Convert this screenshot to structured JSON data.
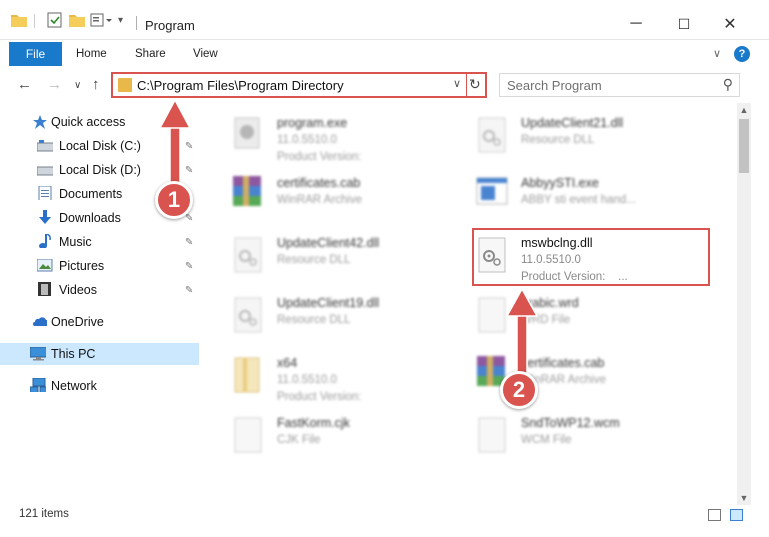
{
  "window": {
    "title": "Program",
    "minimize_glyph": "─",
    "maximize_glyph": "☐",
    "close_glyph": "✕"
  },
  "ribbon": {
    "tabs": [
      "File",
      "Home",
      "Share",
      "View"
    ],
    "expand_glyph": "∨",
    "help_glyph": "?"
  },
  "address": {
    "path": "C:\\Program Files\\Program Directory",
    "back_glyph": "←",
    "forward_glyph": "→",
    "recent_glyph": "∨",
    "up_glyph": "↑",
    "dropdown_glyph": "∨",
    "refresh_glyph": "↻"
  },
  "search": {
    "placeholder": "Search Program",
    "icon": "search-icon",
    "glyph": "⚲"
  },
  "navpane": {
    "items": [
      {
        "label": "Quick access",
        "icon": "star-icon"
      },
      {
        "label": "Local Disk (C:)",
        "icon": "drive-icon",
        "pinned": true
      },
      {
        "label": "Local Disk (D:)",
        "icon": "drive-icon",
        "pinned": true
      },
      {
        "label": "Documents",
        "icon": "documents-icon",
        "pinned": true
      },
      {
        "label": "Downloads",
        "icon": "downloads-icon",
        "pinned": true
      },
      {
        "label": "Music",
        "icon": "music-icon",
        "pinned": true
      },
      {
        "label": "Pictures",
        "icon": "pictures-icon",
        "pinned": true
      },
      {
        "label": "Videos",
        "icon": "videos-icon",
        "pinned": true
      },
      {
        "label": "OneDrive",
        "icon": "cloud-icon"
      },
      {
        "label": "This PC",
        "icon": "computer-icon",
        "selected": true
      },
      {
        "label": "Network",
        "icon": "network-icon"
      }
    ],
    "pin_glyph": "📌"
  },
  "files": {
    "left": [
      {
        "name": "program.exe",
        "line2": "11.0.5510.0",
        "line3": "Product Version:"
      },
      {
        "name": "certificates.cab",
        "line2": "WinRAR Archive",
        "line3": ""
      },
      {
        "name": "UpdateClient42.dll",
        "line2": "Resource DLL",
        "line3": ""
      },
      {
        "name": "UpdateClient19.dll",
        "line2": "Resource DLL",
        "line3": ""
      },
      {
        "name": "x64",
        "line2": "11.0.5510.0",
        "line3": "Product Version:"
      },
      {
        "name": "FastKorm.cjk",
        "line2": "CJK File",
        "line3": ""
      }
    ],
    "right": [
      {
        "name": "UpdateClient21.dll",
        "line2": "Resource DLL",
        "line3": ""
      },
      {
        "name": "AbbyySTI.exe",
        "line2": "ABBY sti event hand...",
        "line3": ""
      },
      {
        "name": "mswbclng.dll",
        "line2": "11.0.5510.0",
        "line3": "Product Version:",
        "line3_suffix": "...",
        "highlighted": true
      },
      {
        "name": "arabic.wrd",
        "line2": "WRD File",
        "line3": ""
      },
      {
        "name": "certificates.cab",
        "line2": "WinRAR Archive",
        "line3": ""
      },
      {
        "name": "SndToWP12.wcm",
        "line2": "WCM File",
        "line3": ""
      }
    ]
  },
  "scrollbar": {
    "up_glyph": "▲",
    "down_glyph": "▼"
  },
  "status": {
    "item_count": "121 items"
  },
  "annotations": {
    "badge1": "1",
    "badge2": "2"
  },
  "colors": {
    "accent": "#1979ca",
    "highlight": "#d9534f",
    "selected": "#cce8ff",
    "folder": "#e8b94a"
  }
}
